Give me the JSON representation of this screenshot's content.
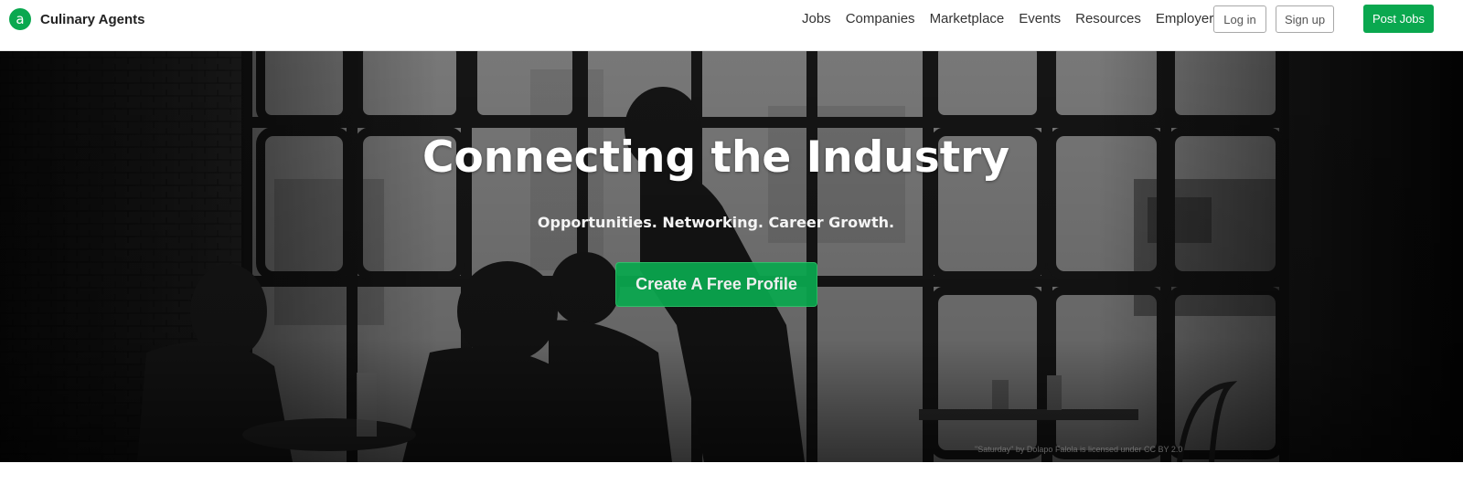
{
  "brand": {
    "name": "Culinary Agents",
    "logo_letter": "a",
    "color": "#0aa84f"
  },
  "nav": {
    "links": [
      "Jobs",
      "Companies",
      "Marketplace",
      "Events",
      "Resources",
      "Employer"
    ],
    "login_label": "Log in",
    "signup_label": "Sign up",
    "post_jobs_label": "Post Jobs"
  },
  "hero": {
    "title": "Connecting the Industry",
    "subtitle": "Opportunities. Networking. Career Growth.",
    "cta_label": "Create A Free Profile",
    "photo_credit": "\"Saturday\" by Dolapo Falola is licensed under CC BY 2.0"
  }
}
